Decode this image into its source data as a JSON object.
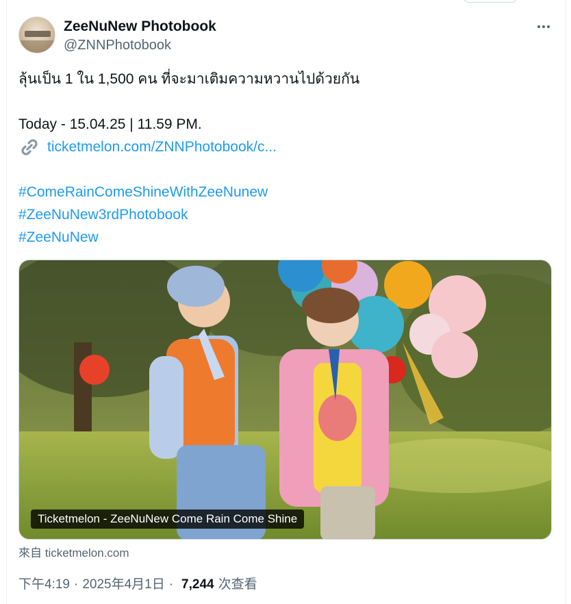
{
  "author": {
    "display_name": "ZeeNuNew Photobook",
    "handle": "@ZNNPhotobook"
  },
  "tweet": {
    "line1": "ลุ้นเป็น 1 ใน 1,500 คน ที่จะมาเติมความหวานไปด้วยกัน",
    "line2": "Today - 15.04.25 | 11.59 PM.",
    "link_text": "ticketmelon.com/ZNNPhotobook/c...",
    "hashtags": [
      "#ComeRainComeShineWithZeeNunew",
      "#ZeeNuNew3rdPhotobook",
      "#ZeeNuNew"
    ]
  },
  "card": {
    "title": "Ticketmelon - ZeeNuNew Come Rain Come Shine",
    "source": "來自 ticketmelon.com"
  },
  "meta": {
    "time": "下午4:19",
    "date": "2025年4月1日",
    "views_count": "7,244",
    "views_label": "次查看"
  },
  "icons": {
    "more": "more-horizontal-icon",
    "link": "link-chain-icon"
  },
  "colors": {
    "link": "#1d9bf0",
    "secondary_text": "#536471",
    "primary_text": "#0f1419"
  }
}
